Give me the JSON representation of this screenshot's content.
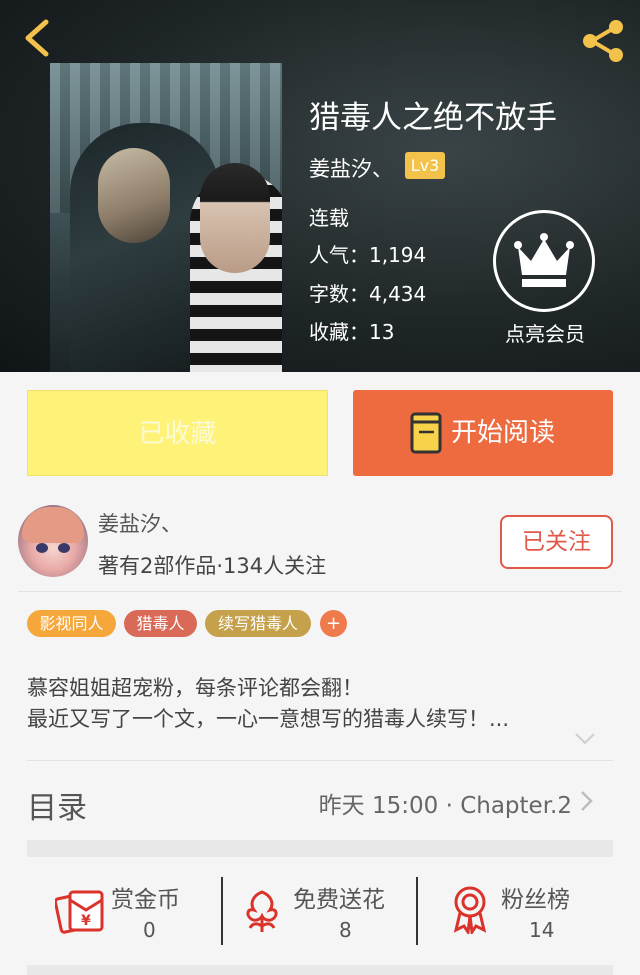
{
  "book": {
    "title": "猎毒人之绝不放手",
    "author": "姜盐汐、",
    "level": "Lv3",
    "status": "连载",
    "popularity": "人气：1,194",
    "word_count": "字数：4,434",
    "favorites": "收藏：13",
    "vip_label": "点亮会员"
  },
  "actions": {
    "favorited_label": "已收藏",
    "read_label": "开始阅读"
  },
  "author_info": {
    "name": "姜盐汐、",
    "meta": "著有2部作品·134人关注",
    "follow_label": "已关注"
  },
  "tags": [
    {
      "label": "影视同人",
      "color": "#f5a73b"
    },
    {
      "label": "猎毒人",
      "color": "#d86a57"
    },
    {
      "label": "续写猎毒人",
      "color": "#c4a14a"
    }
  ],
  "description": {
    "line1": "慕容姐姐超宠粉，每条评论都会翻！",
    "line2": "最近又写了一个文，一心一意想写的猎毒人续写！..."
  },
  "catalog": {
    "title": "目录",
    "latest": "昨天 15:00 · Chapter.2"
  },
  "stats": {
    "reward_label": "赏金币",
    "reward_value": "0",
    "flower_label": "免费送花",
    "flower_value": "8",
    "fans_label": "粉丝榜",
    "fans_value": "14"
  },
  "colors": {
    "accent_orange": "#ee6a3f",
    "favorited_yellow": "#fef278",
    "follow_red": "#e05a4a",
    "level_badge": "#f3c24a",
    "icon_red": "#d9332b"
  },
  "icons": [
    "back-arrow-icon",
    "share-icon",
    "crown-icon",
    "book-icon",
    "chevron-down-icon",
    "chevron-right-icon",
    "red-envelope-icon",
    "flower-icon",
    "medal-icon"
  ]
}
